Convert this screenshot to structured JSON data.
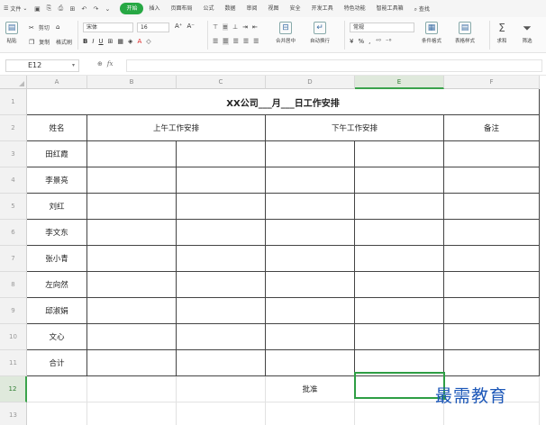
{
  "menu": {
    "file_label": "文件"
  },
  "tabs": [
    {
      "label": "开始",
      "active": true
    },
    {
      "label": "插入",
      "active": false
    },
    {
      "label": "页面布局",
      "active": false
    },
    {
      "label": "公式",
      "active": false
    },
    {
      "label": "数据",
      "active": false
    },
    {
      "label": "审阅",
      "active": false
    },
    {
      "label": "视图",
      "active": false
    },
    {
      "label": "安全",
      "active": false
    },
    {
      "label": "开发工具",
      "active": false
    },
    {
      "label": "特色功能",
      "active": false
    },
    {
      "label": "智能工具箱",
      "active": false
    }
  ],
  "search_label": "查找",
  "ribbon": {
    "paste_label": "粘贴",
    "cut_label": "剪切",
    "copy_label": "复制",
    "format_painter_label": "格式刷",
    "font_name": "宋体",
    "font_size": "16",
    "merge_label": "合并居中",
    "wrap_label": "自动换行",
    "number_format": "常规",
    "cond_format_label": "条件格式",
    "table_style_label": "表格样式",
    "sum_label": "求和",
    "filter_label": "筛选"
  },
  "formula_bar": {
    "cell_ref": "E12",
    "fx_label": "fx",
    "formula": ""
  },
  "columns": [
    "A",
    "B",
    "C",
    "D",
    "E",
    "F"
  ],
  "rows": [
    "1",
    "2",
    "3",
    "4",
    "5",
    "6",
    "7",
    "8",
    "9",
    "10",
    "11",
    "12",
    "13"
  ],
  "sheet": {
    "title": "XX公司___月___日工作安排",
    "header_name": "姓名",
    "header_morning": "上午工作安排",
    "header_afternoon": "下午工作安排",
    "header_notes": "备注",
    "names": [
      "田红霞",
      "李景亮",
      "刘红",
      "李文东",
      "张小青",
      "左向然",
      "邱淑娟",
      "文心",
      "合计"
    ],
    "approve_label": "批准"
  },
  "selected_cell": "E12",
  "colors": {
    "accent": "#27a844",
    "selection": "#2e9e44",
    "watermark": "#1c57b8"
  },
  "watermark": "最需教育"
}
